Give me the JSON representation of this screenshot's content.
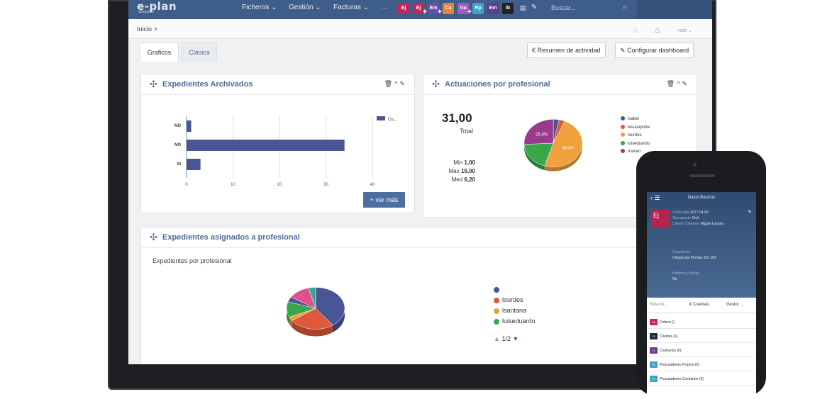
{
  "navbar": {
    "logo": "e-plan",
    "logo_sub": "abogados",
    "menus": [
      "Ficheros",
      "Gestión",
      "Facturas"
    ],
    "dots": "...",
    "quick_icons": [
      {
        "label": "Ej",
        "color": "#c4265a",
        "plus": false
      },
      {
        "label": "Ej",
        "color": "#c4265a",
        "plus": true
      },
      {
        "label": "Em",
        "color": "#6a4fa8",
        "plus": true
      },
      {
        "label": "Ca",
        "color": "#e8843a",
        "plus": false
      },
      {
        "label": "Ga",
        "color": "#a05cc0",
        "plus": true
      },
      {
        "label": "Rp",
        "color": "#3fa3c8",
        "plus": false
      },
      {
        "label": "Em",
        "color": "#5a3f8f",
        "plus": false
      },
      {
        "label": "Ib",
        "color": "#222222",
        "plus": false
      }
    ],
    "search_placeholder": "Buscar..."
  },
  "subbar": {
    "breadcrumb": "Inicio >",
    "user": "root"
  },
  "tabs": {
    "active": "Graficos",
    "inactive": "Clásica"
  },
  "buttons": {
    "resumen": "€ Resumen de actividad",
    "configurar": "Configurar dashboard"
  },
  "panel_archivados": {
    "title": "Expedientes Archivados",
    "ver_mas": "+ ver más",
    "legend": "Cu...",
    "chart_data": {
      "type": "bar",
      "orientation": "horizontal",
      "categories": [
        "NO",
        "NO",
        "SI"
      ],
      "values": [
        1,
        34,
        3
      ],
      "xlim": [
        0,
        40
      ],
      "xticks": [
        "0",
        "10",
        "20",
        "30",
        "40"
      ],
      "series_color": "#4a5596"
    }
  },
  "panel_actuaciones": {
    "title": "Actuaciones por profesional",
    "total_value": "31,00",
    "total_label": "Total",
    "min_label": "Min",
    "min_value": "1,00",
    "max_label": "Max",
    "max_value": "15,00",
    "med_label": "Med",
    "med_value": "6,20",
    "chart_data": {
      "type": "pie",
      "labels": [
        "isabel",
        "lesusoporte",
        "lourdes",
        "luiseduardo",
        "marian"
      ],
      "values": [
        3.2,
        3.2,
        48.4,
        19.4,
        25.8
      ],
      "colors": [
        "#4a5596",
        "#e0583a",
        "#f0a03c",
        "#3aa64a",
        "#9a3a8a"
      ],
      "slice_labels": [
        "25,8%",
        "48,4%"
      ]
    }
  },
  "panel_asignados": {
    "title": "Expedientes asignados a profesional",
    "subtitle": "Expedientes por profesional",
    "legend": [
      "",
      "lourdes",
      "lsantana",
      "luiseduardo"
    ],
    "legend_colors": [
      "#4a5596",
      "#e0583a",
      "#f0a03c",
      "#3aa64a"
    ],
    "pager": "1/2",
    "chart_data": {
      "type": "pie",
      "values": [
        40,
        25,
        3,
        12,
        4,
        12,
        4
      ],
      "colors": [
        "#4a5596",
        "#e0583a",
        "#f0a03c",
        "#3aa64a",
        "#4a5596",
        "#e0508a",
        "#3aa6a0"
      ]
    }
  },
  "phone": {
    "title": "Datos Basicos",
    "badge": "Ej",
    "fields": [
      {
        "label": "Fecha Alta",
        "value": "2017-04-06"
      },
      {
        "label": "Tipo asunto",
        "value": "Civil"
      },
      {
        "label": "Cliente (Clientes)",
        "value": "Miguel Lozano"
      }
    ],
    "expediente_label": "Expediente",
    "expediente_value": "Diligencias Previas 102 103",
    "historico_label": "Historico y Notas",
    "historico_value": "No",
    "tabs": [
      "Relacio...",
      "€ Cuentas",
      "Gestor ..."
    ],
    "rows": [
      {
        "label": "Cobros ()",
        "badge": "Cb",
        "color": "#c4265a"
      },
      {
        "label": "Clientes (1)",
        "badge": "Cl",
        "color": "#2b2b3a"
      },
      {
        "label": "Contrarios (0)",
        "badge": "Ct",
        "color": "#6a3f8f"
      },
      {
        "label": "Procuradores Propios (0)",
        "badge": "Pr",
        "color": "#3fa3c8"
      },
      {
        "label": "Procuradores Contrarios (0)",
        "badge": "Pc",
        "color": "#3fa3c8"
      }
    ]
  }
}
